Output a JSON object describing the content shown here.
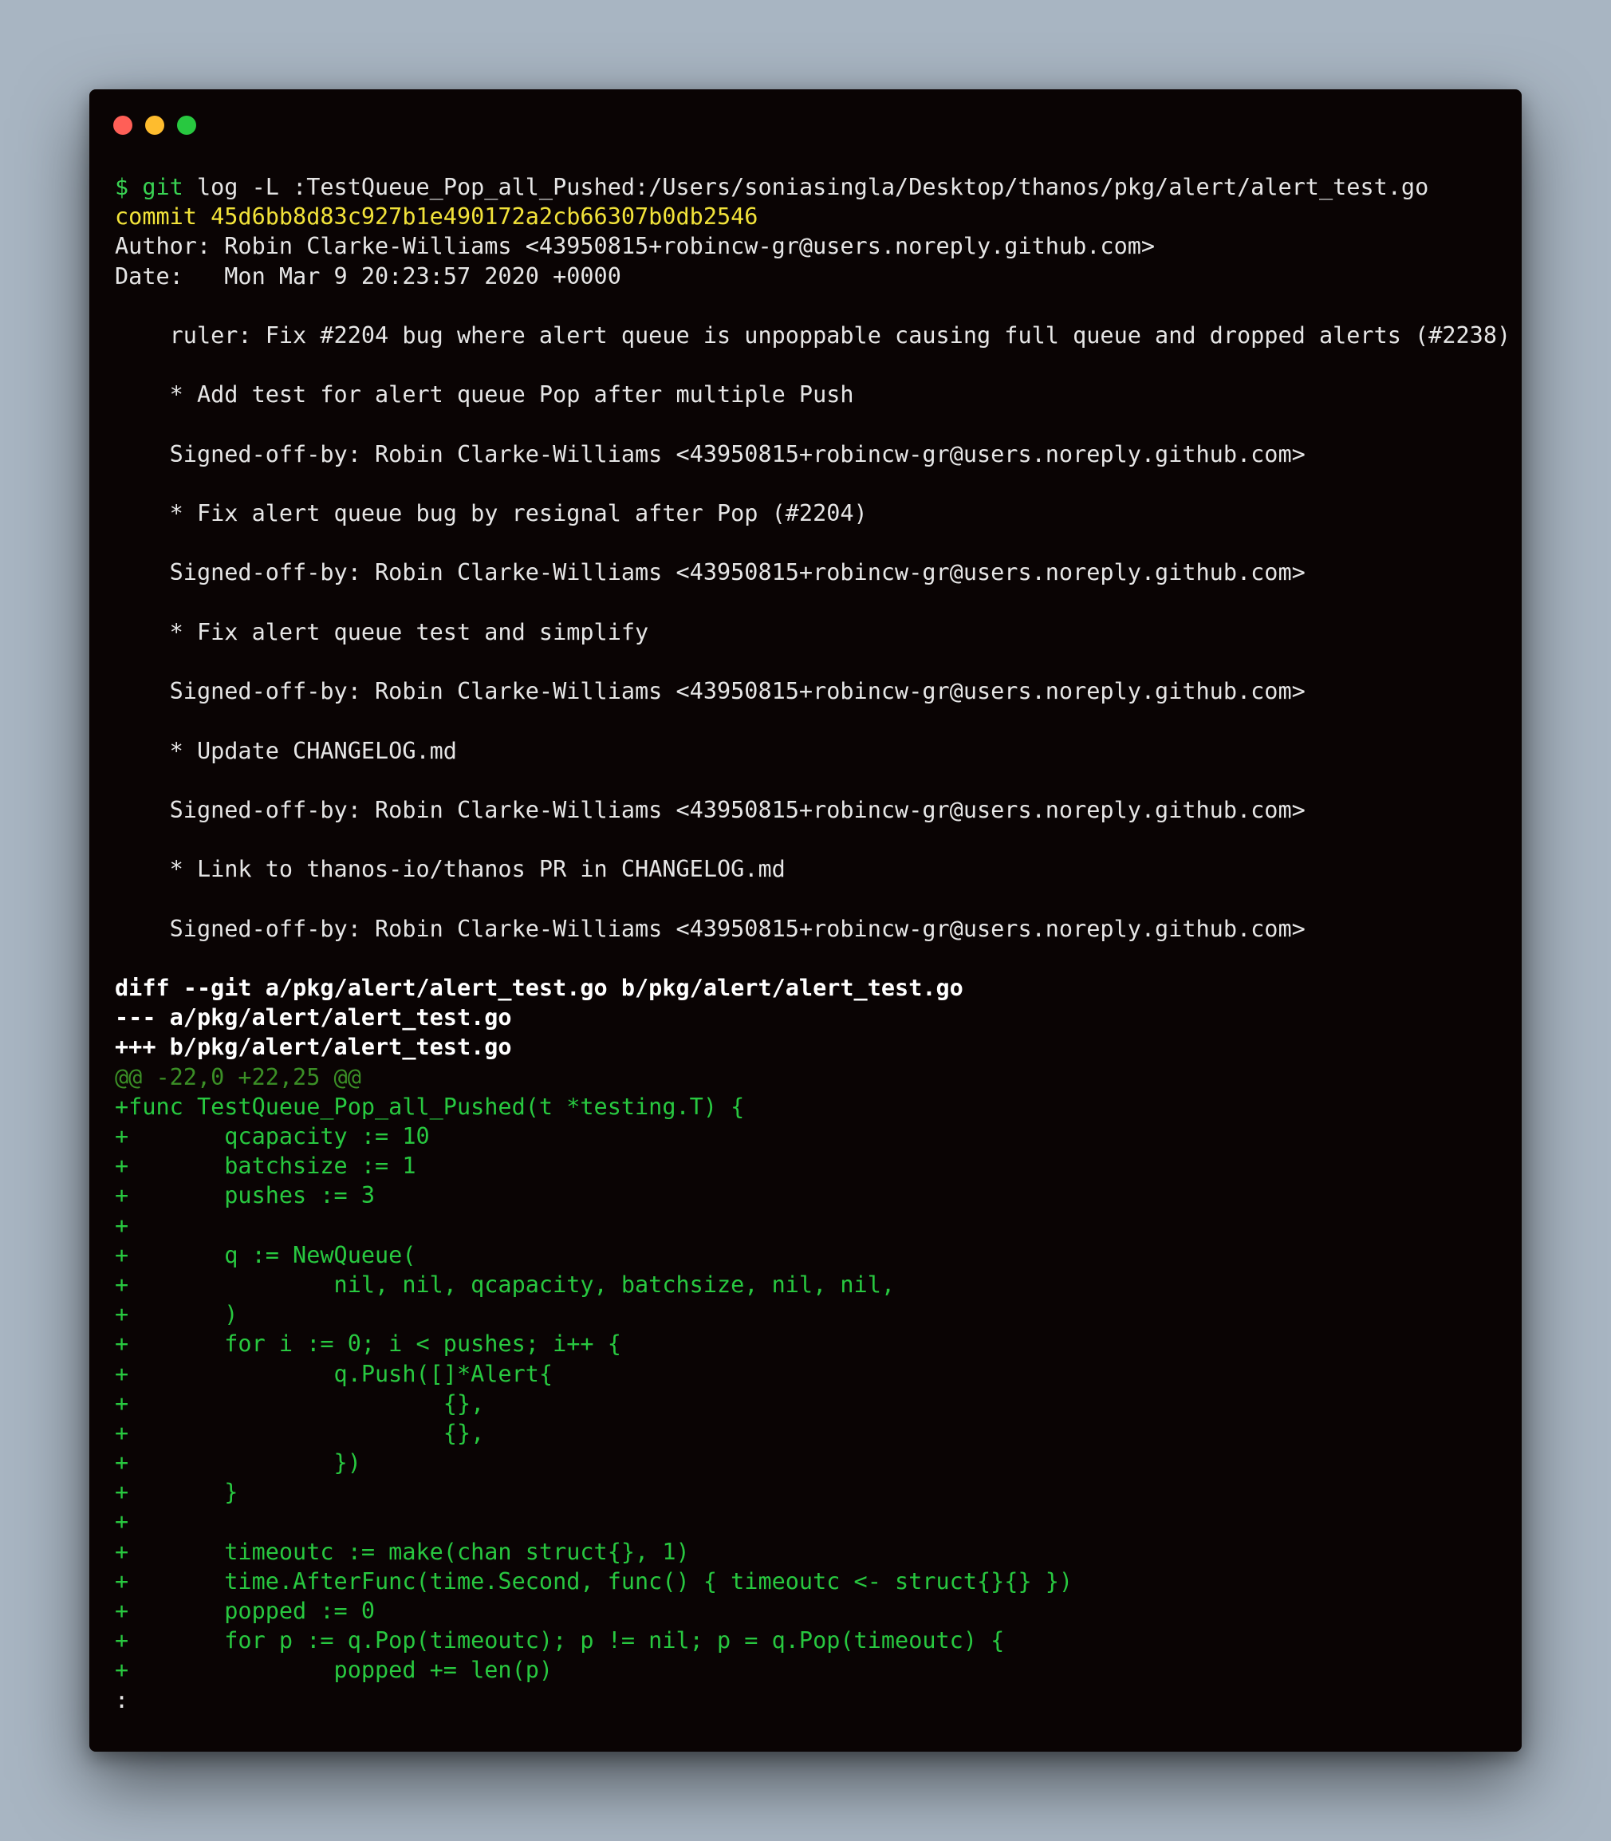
{
  "window": {
    "buttons": [
      {
        "name": "close-button",
        "color": "#ff5f57"
      },
      {
        "name": "minimize-button",
        "color": "#febc2e"
      },
      {
        "name": "zoom-button",
        "color": "#28c840"
      }
    ]
  },
  "colors": {
    "text": "#e6e6e6",
    "prompt": "#39d353",
    "commit": "#f2e33a",
    "diff_add": "#28c840",
    "hunk": "#3b8f26",
    "background": "#0a0404"
  },
  "terminal": {
    "lines": [
      {
        "segments": [
          {
            "text": "$ ",
            "color": "#39d353"
          },
          {
            "text": "git",
            "color": "#39d353"
          },
          {
            "text": " log -L :TestQueue_Pop_all_Pushed:/Users/soniasingla/Desktop/thanos/pkg/alert/alert_test.go",
            "color": "#e6e6e6"
          }
        ]
      },
      {
        "segments": [
          {
            "text": "commit 45d6bb8d83c927b1e490172a2cb66307b0db2546",
            "color": "#f2e33a"
          }
        ]
      },
      {
        "segments": [
          {
            "text": "Author: Robin Clarke-Williams <43950815+robincw-gr@users.noreply.github.com>",
            "color": "#e6e6e6"
          }
        ]
      },
      {
        "segments": [
          {
            "text": "Date:   Mon Mar 9 20:23:57 2020 +0000",
            "color": "#e6e6e6"
          }
        ]
      },
      {
        "segments": [
          {
            "text": "",
            "color": "#e6e6e6"
          }
        ]
      },
      {
        "segments": [
          {
            "text": "    ruler: Fix #2204 bug where alert queue is unpoppable causing full queue and dropped alerts (#2238)",
            "color": "#e6e6e6"
          }
        ]
      },
      {
        "segments": [
          {
            "text": "",
            "color": "#e6e6e6"
          }
        ]
      },
      {
        "segments": [
          {
            "text": "    * Add test for alert queue Pop after multiple Push",
            "color": "#e6e6e6"
          }
        ]
      },
      {
        "segments": [
          {
            "text": "",
            "color": "#e6e6e6"
          }
        ]
      },
      {
        "segments": [
          {
            "text": "    Signed-off-by: Robin Clarke-Williams <43950815+robincw-gr@users.noreply.github.com>",
            "color": "#e6e6e6"
          }
        ]
      },
      {
        "segments": [
          {
            "text": "",
            "color": "#e6e6e6"
          }
        ]
      },
      {
        "segments": [
          {
            "text": "    * Fix alert queue bug by resignal after Pop (#2204)",
            "color": "#e6e6e6"
          }
        ]
      },
      {
        "segments": [
          {
            "text": "",
            "color": "#e6e6e6"
          }
        ]
      },
      {
        "segments": [
          {
            "text": "    Signed-off-by: Robin Clarke-Williams <43950815+robincw-gr@users.noreply.github.com>",
            "color": "#e6e6e6"
          }
        ]
      },
      {
        "segments": [
          {
            "text": "",
            "color": "#e6e6e6"
          }
        ]
      },
      {
        "segments": [
          {
            "text": "    * Fix alert queue test and simplify",
            "color": "#e6e6e6"
          }
        ]
      },
      {
        "segments": [
          {
            "text": "",
            "color": "#e6e6e6"
          }
        ]
      },
      {
        "segments": [
          {
            "text": "    Signed-off-by: Robin Clarke-Williams <43950815+robincw-gr@users.noreply.github.com>",
            "color": "#e6e6e6"
          }
        ]
      },
      {
        "segments": [
          {
            "text": "",
            "color": "#e6e6e6"
          }
        ]
      },
      {
        "segments": [
          {
            "text": "    * Update CHANGELOG.md",
            "color": "#e6e6e6"
          }
        ]
      },
      {
        "segments": [
          {
            "text": "",
            "color": "#e6e6e6"
          }
        ]
      },
      {
        "segments": [
          {
            "text": "    Signed-off-by: Robin Clarke-Williams <43950815+robincw-gr@users.noreply.github.com>",
            "color": "#e6e6e6"
          }
        ]
      },
      {
        "segments": [
          {
            "text": "",
            "color": "#e6e6e6"
          }
        ]
      },
      {
        "segments": [
          {
            "text": "    * Link to thanos-io/thanos PR in CHANGELOG.md",
            "color": "#e6e6e6"
          }
        ]
      },
      {
        "segments": [
          {
            "text": "",
            "color": "#e6e6e6"
          }
        ]
      },
      {
        "segments": [
          {
            "text": "    Signed-off-by: Robin Clarke-Williams <43950815+robincw-gr@users.noreply.github.com>",
            "color": "#e6e6e6"
          }
        ]
      },
      {
        "segments": [
          {
            "text": "",
            "color": "#e6e6e6"
          }
        ]
      },
      {
        "segments": [
          {
            "text": "diff --git a/pkg/alert/alert_test.go b/pkg/alert/alert_test.go",
            "color": "#ffffff",
            "bold": true
          }
        ]
      },
      {
        "segments": [
          {
            "text": "--- a/pkg/alert/alert_test.go",
            "color": "#ffffff",
            "bold": true
          }
        ]
      },
      {
        "segments": [
          {
            "text": "+++ b/pkg/alert/alert_test.go",
            "color": "#ffffff",
            "bold": true
          }
        ]
      },
      {
        "segments": [
          {
            "text": "@@ -22,0 +22,25 @@",
            "color": "#3b8f26"
          }
        ]
      },
      {
        "segments": [
          {
            "text": "+func TestQueue_Pop_all_Pushed(t *testing.T) {",
            "color": "#28c840"
          }
        ]
      },
      {
        "segments": [
          {
            "text": "+       qcapacity := 10",
            "color": "#28c840"
          }
        ]
      },
      {
        "segments": [
          {
            "text": "+       batchsize := 1",
            "color": "#28c840"
          }
        ]
      },
      {
        "segments": [
          {
            "text": "+       pushes := 3",
            "color": "#28c840"
          }
        ]
      },
      {
        "segments": [
          {
            "text": "+",
            "color": "#28c840"
          }
        ]
      },
      {
        "segments": [
          {
            "text": "+       q := NewQueue(",
            "color": "#28c840"
          }
        ]
      },
      {
        "segments": [
          {
            "text": "+               nil, nil, qcapacity, batchsize, nil, nil,",
            "color": "#28c840"
          }
        ]
      },
      {
        "segments": [
          {
            "text": "+       )",
            "color": "#28c840"
          }
        ]
      },
      {
        "segments": [
          {
            "text": "+       for i := 0; i < pushes; i++ {",
            "color": "#28c840"
          }
        ]
      },
      {
        "segments": [
          {
            "text": "+               q.Push([]*Alert{",
            "color": "#28c840"
          }
        ]
      },
      {
        "segments": [
          {
            "text": "+                       {},",
            "color": "#28c840"
          }
        ]
      },
      {
        "segments": [
          {
            "text": "+                       {},",
            "color": "#28c840"
          }
        ]
      },
      {
        "segments": [
          {
            "text": "+               })",
            "color": "#28c840"
          }
        ]
      },
      {
        "segments": [
          {
            "text": "+       }",
            "color": "#28c840"
          }
        ]
      },
      {
        "segments": [
          {
            "text": "+",
            "color": "#28c840"
          }
        ]
      },
      {
        "segments": [
          {
            "text": "+       timeoutc := make(chan struct{}, 1)",
            "color": "#28c840"
          }
        ]
      },
      {
        "segments": [
          {
            "text": "+       time.AfterFunc(time.Second, func() { timeoutc <- struct{}{} })",
            "color": "#28c840"
          }
        ]
      },
      {
        "segments": [
          {
            "text": "+       popped := 0",
            "color": "#28c840"
          }
        ]
      },
      {
        "segments": [
          {
            "text": "+       for p := q.Pop(timeoutc); p != nil; p = q.Pop(timeoutc) {",
            "color": "#28c840"
          }
        ]
      },
      {
        "segments": [
          {
            "text": "+               popped += len(p)",
            "color": "#28c840"
          }
        ]
      },
      {
        "segments": [
          {
            "text": ":",
            "color": "#e6e6e6"
          }
        ]
      }
    ]
  }
}
